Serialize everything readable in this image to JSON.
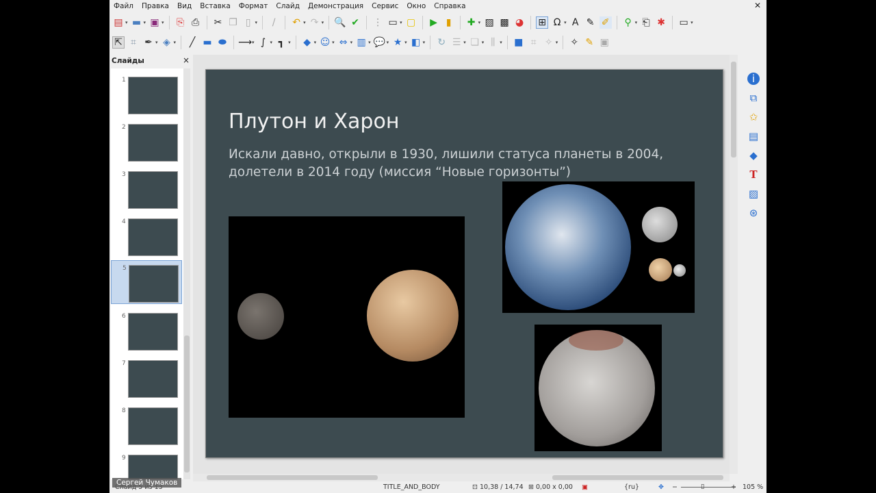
{
  "menu": [
    "Файл",
    "Правка",
    "Вид",
    "Вставка",
    "Формат",
    "Слайд",
    "Демонстрация",
    "Сервис",
    "Окно",
    "Справка"
  ],
  "panel": {
    "title": "Слайды",
    "slides": [
      "1",
      "2",
      "3",
      "4",
      "5",
      "6",
      "7",
      "8",
      "9"
    ],
    "selected": "5"
  },
  "slide": {
    "title": "Плутон и Харон",
    "subtitle": "Искали давно, открыли в 1930, лишили статуса планеты в 2004, долетели в 2014 году (миссия “Новые горизонты”)"
  },
  "status": {
    "slide_pos": "Слайд 5 из 13",
    "layout": "TITLE_AND_BODY",
    "position": "10,38 / 14,74",
    "size": "0,00 x 0,00",
    "lang": "{ru}",
    "zoom": "105 %"
  },
  "overlay_user": "Сергей Чумаков",
  "colors": {
    "slide_bg": "#3d4b50",
    "selection": "#c7d9ef"
  }
}
